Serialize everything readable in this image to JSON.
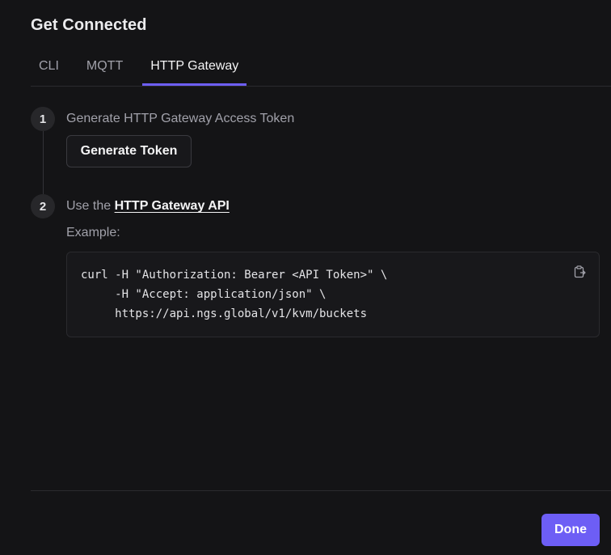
{
  "dialog": {
    "title": "Get Connected"
  },
  "tabs": [
    {
      "label": "CLI",
      "active": false
    },
    {
      "label": "MQTT",
      "active": false
    },
    {
      "label": "HTTP Gateway",
      "active": true
    }
  ],
  "steps": [
    {
      "number": "1",
      "text": "Generate HTTP Gateway Access Token",
      "button_label": "Generate Token"
    },
    {
      "number": "2",
      "text_prefix": "Use the ",
      "link_text": "HTTP Gateway API",
      "example_label": "Example:",
      "code_lines": [
        "curl -H \"Authorization: Bearer <API Token>\" \\",
        "     -H \"Accept: application/json\" \\",
        "     https://api.ngs.global/v1/kvm/buckets"
      ],
      "copy_icon": "clipboard-icon"
    }
  ],
  "footer": {
    "done_label": "Done"
  },
  "colors": {
    "background": "#141416",
    "accent": "#6d5ef5",
    "muted_text": "#a1a1aa"
  }
}
